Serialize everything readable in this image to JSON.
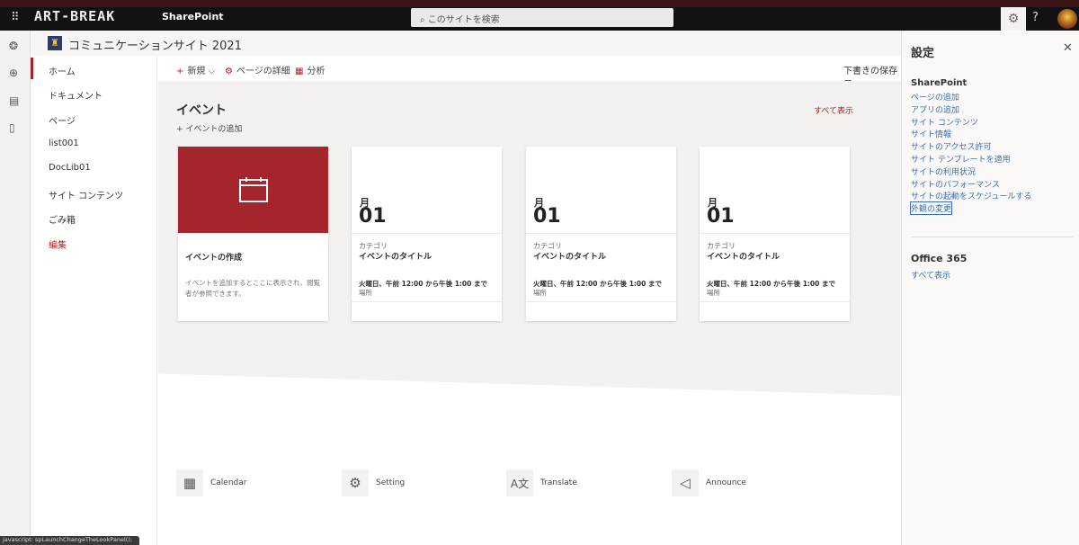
{
  "topbar": {
    "logo": "ART-BREAK",
    "app": "SharePoint",
    "search_placeholder": "このサイトを検索",
    "help": "?"
  },
  "site": {
    "title": "コミュニケーションサイト 2021"
  },
  "nav": {
    "items": [
      "ホーム",
      "ドキュメント",
      "ページ",
      "list001",
      "DocLib01",
      "サイト コンテンツ",
      "ごみ箱"
    ],
    "edit": "編集"
  },
  "commandbar": {
    "new": "新規",
    "page_details": "ページの詳細",
    "analytics": "分析",
    "draft_saved": "下書きの保存日"
  },
  "events": {
    "title": "イベント",
    "see_all": "すべて表示",
    "add": "イベントの追加",
    "create_card": {
      "title": "イベントの作成",
      "desc": "イベントを追加するとここに表示され、閲覧者が参照できます。"
    },
    "cards": [
      {
        "month": "月",
        "day": "01",
        "category": "カテゴリ",
        "title": "イベントのタイトル",
        "time": "火曜日、午前 12:00 から午後 1:00 まで",
        "location": "場所"
      },
      {
        "month": "月",
        "day": "01",
        "category": "カテゴリ",
        "title": "イベントのタイトル",
        "time": "火曜日、午前 12:00 から午後 1:00 まで",
        "location": "場所"
      },
      {
        "month": "月",
        "day": "01",
        "category": "カテゴリ",
        "title": "イベントのタイトル",
        "time": "火曜日、午前 12:00 から午後 1:00 まで",
        "location": "場所"
      }
    ]
  },
  "quicklinks": [
    "Calendar",
    "Setting",
    "Translate",
    "Announce"
  ],
  "settings": {
    "title": "設定",
    "sharepoint_heading": "SharePoint",
    "links": [
      "ページの追加",
      "アプリの追加",
      "サイト コンテンツ",
      "サイト情報",
      "サイトのアクセス許可",
      "サイト テンプレートを適用",
      "サイトの利用状況",
      "サイトのパフォーマンス",
      "サイトの起動をスケジュールする",
      "外観の変更"
    ],
    "office_heading": "Office 365",
    "office_link": "すべて表示"
  },
  "statusbar": "javascript: spLaunchChangeTheLookPanel();",
  "colors": {
    "accent": "#a4262c",
    "link": "#3b6fb6"
  }
}
